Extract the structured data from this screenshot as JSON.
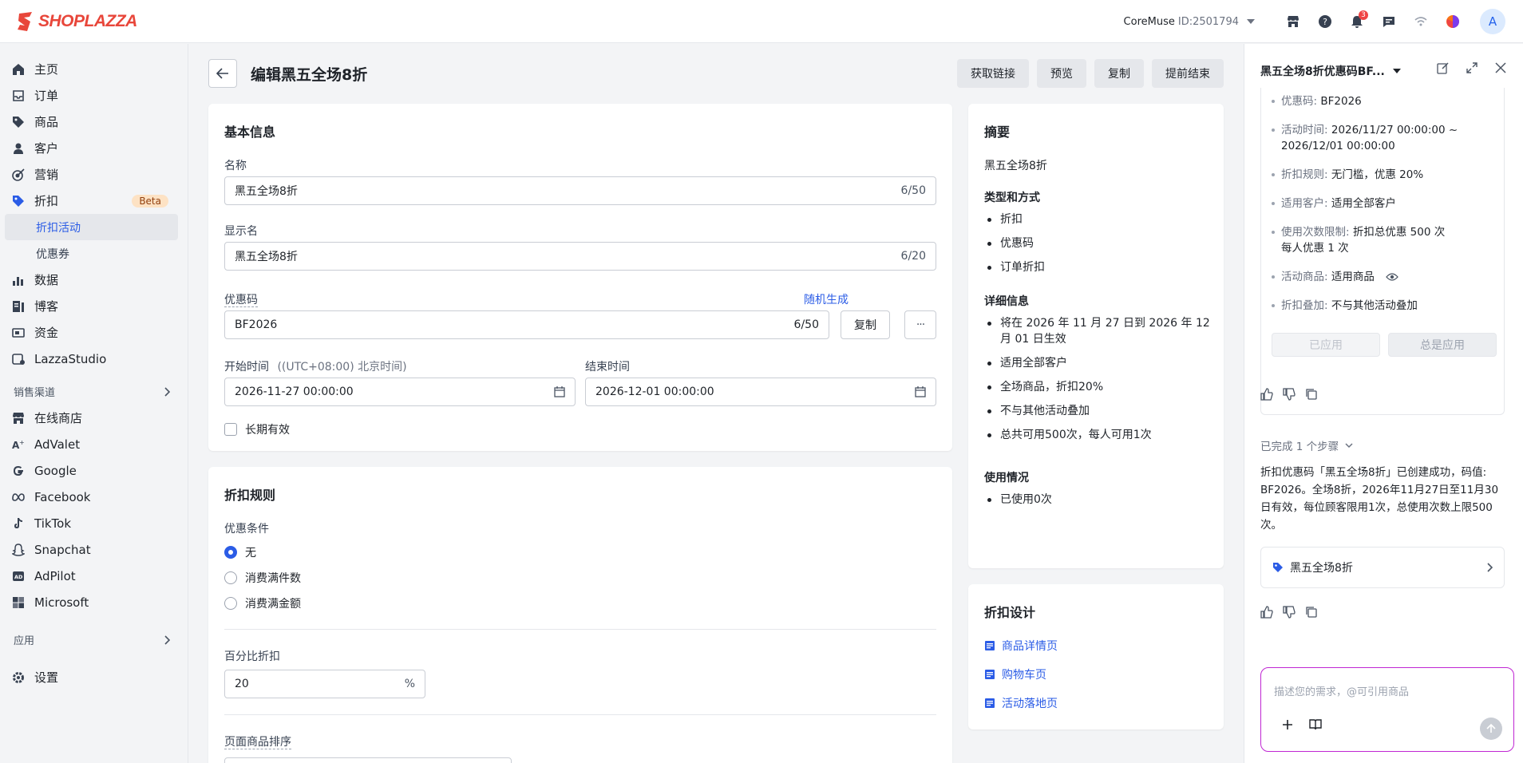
{
  "brand": {
    "name": "SHOPLAZZA",
    "color": "#e8463a"
  },
  "topbar": {
    "store_name": "CoreMuse",
    "store_id": "ID:2501794",
    "notification_count": "3",
    "avatar_letter": "A"
  },
  "sidebar": {
    "items": [
      {
        "label": "主页",
        "icon": "home-icon"
      },
      {
        "label": "订单",
        "icon": "inbox-icon"
      },
      {
        "label": "商品",
        "icon": "tag-icon"
      },
      {
        "label": "客户",
        "icon": "user-icon"
      },
      {
        "label": "营销",
        "icon": "target-icon"
      },
      {
        "label": "折扣",
        "icon": "discount-icon",
        "badge": "Beta"
      }
    ],
    "discount_sub": [
      "折扣活动",
      "优惠券"
    ],
    "items2": [
      {
        "label": "数据",
        "icon": "bar-chart-icon"
      },
      {
        "label": "博客",
        "icon": "blog-icon"
      },
      {
        "label": "资金",
        "icon": "wallet-icon"
      },
      {
        "label": "LazzaStudio",
        "icon": "studio-icon"
      }
    ],
    "channels_title": "销售渠道",
    "channels": [
      {
        "label": "在线商店",
        "icon": "store-icon"
      },
      {
        "label": "AdValet",
        "icon": "advalet-icon"
      },
      {
        "label": "Google",
        "icon": "google-icon"
      },
      {
        "label": "Facebook",
        "icon": "meta-icon"
      },
      {
        "label": "TikTok",
        "icon": "tiktok-icon"
      },
      {
        "label": "Snapchat",
        "icon": "snapchat-icon"
      },
      {
        "label": "AdPilot",
        "icon": "adpilot-icon"
      },
      {
        "label": "Microsoft",
        "icon": "microsoft-icon"
      }
    ],
    "apps_title": "应用",
    "settings": "设置"
  },
  "page": {
    "title": "编辑黑五全场8折",
    "actions": [
      "获取链接",
      "预览",
      "复制",
      "提前结束"
    ]
  },
  "basic": {
    "title": "基本信息",
    "name_label": "名称",
    "name_value": "黑五全场8折",
    "name_count": "6/50",
    "display_label": "显示名",
    "display_value": "黑五全场8折",
    "display_count": "6/20",
    "code_label": "优惠码",
    "random_link": "随机生成",
    "code_value": "BF2026",
    "code_count": "6/50",
    "copy_btn": "复制",
    "more_btn": "···",
    "start_label": "开始时间",
    "start_tz": "((UTC+08:00) 北京时间)",
    "start_value": "2026-11-27 00:00:00",
    "end_label": "结束时间",
    "end_value": "2026-12-01 00:00:00",
    "longterm": "长期有效"
  },
  "rules": {
    "title": "折扣规则",
    "cond_label": "优惠条件",
    "options": [
      "无",
      "消费满件数",
      "消费满金额"
    ],
    "selected": 0,
    "percent_label": "百分比折扣",
    "percent_value": "20",
    "percent_unit": "%",
    "sort_label": "页面商品排序"
  },
  "summary": {
    "title": "摘要",
    "name": "黑五全场8折",
    "type_title": "类型和方式",
    "types": [
      "折扣",
      "优惠码",
      "订单折扣"
    ],
    "detail_title": "详细信息",
    "details": [
      "将在 2026 年 11 月 27 日到 2026 年 12 月 01 日生效",
      "适用全部客户",
      "全场商品，折扣20%",
      "不与其他活动叠加",
      "总共可用500次，每人可用1次"
    ],
    "usage_title": "使用情况",
    "usage": [
      "已使用0次"
    ]
  },
  "design": {
    "title": "折扣设计",
    "links": [
      "商品详情页",
      "购物车页",
      "活动落地页"
    ]
  },
  "panel": {
    "title": "黑五全场8折优惠码BF...",
    "details": [
      {
        "k": "优惠码:",
        "v": "BF2026"
      },
      {
        "k": "活动时间:",
        "v": "2026/11/27 00:00:00 ~ 2026/12/01 00:00:00"
      },
      {
        "k": "折扣规则:",
        "v": "无门槛，优惠 20%"
      },
      {
        "k": "适用客户:",
        "v": "适用全部客户"
      },
      {
        "k": "使用次数限制:",
        "v": "折扣总优惠 500 次\n每人优惠 1 次"
      },
      {
        "k": "活动商品:",
        "v": "适用商品"
      },
      {
        "k": "折扣叠加:",
        "v": "不与其他活动叠加"
      }
    ],
    "applied_btn": "已应用",
    "always_btn": "总是应用",
    "steps": "已完成 1 个步骤",
    "message": "折扣优惠码「黑五全场8折」已创建成功，码值: BF2026。全场8折，2026年11月27日至11月30日有效，每位顾客限用1次，总使用次数上限500次。",
    "ref_card": "黑五全场8折",
    "input_placeholder": "描述您的需求，@可引用商品",
    "accent": "#c026d3"
  }
}
